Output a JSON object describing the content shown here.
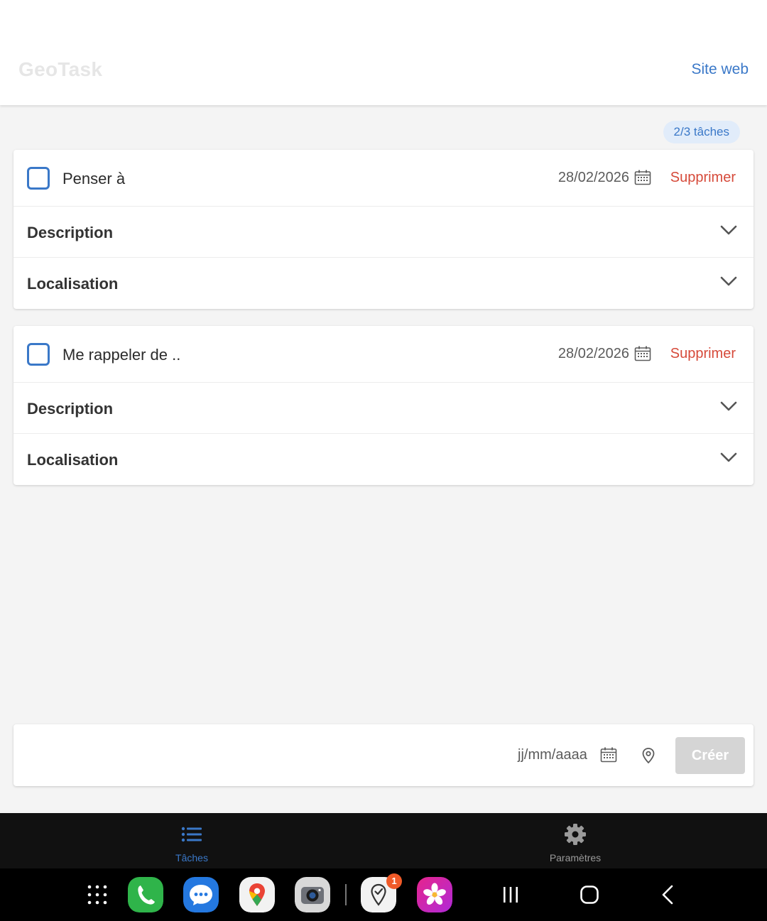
{
  "header": {
    "app_title": "GeoTask",
    "site_link": "Site web"
  },
  "counter": "2/3 tâches",
  "tasks": [
    {
      "title": "Penser à",
      "date": "28/02/2026",
      "delete_label": "Supprimer",
      "sections": [
        "Description",
        "Localisation"
      ]
    },
    {
      "title": "Me rappeler de ..",
      "date": "28/02/2026",
      "delete_label": "Supprimer",
      "sections": [
        "Description",
        "Localisation"
      ]
    }
  ],
  "create_bar": {
    "input_value": "",
    "date_placeholder": "jj/mm/aaaa",
    "create_label": "Créer"
  },
  "bottom_nav": {
    "tasks_label": "Tâches",
    "settings_label": "Paramètres"
  },
  "dock": {
    "notification_badge": "1"
  },
  "colors": {
    "accent": "#3a78c8",
    "danger": "#d64a3a",
    "disabled_button": "#d5d5d5"
  }
}
